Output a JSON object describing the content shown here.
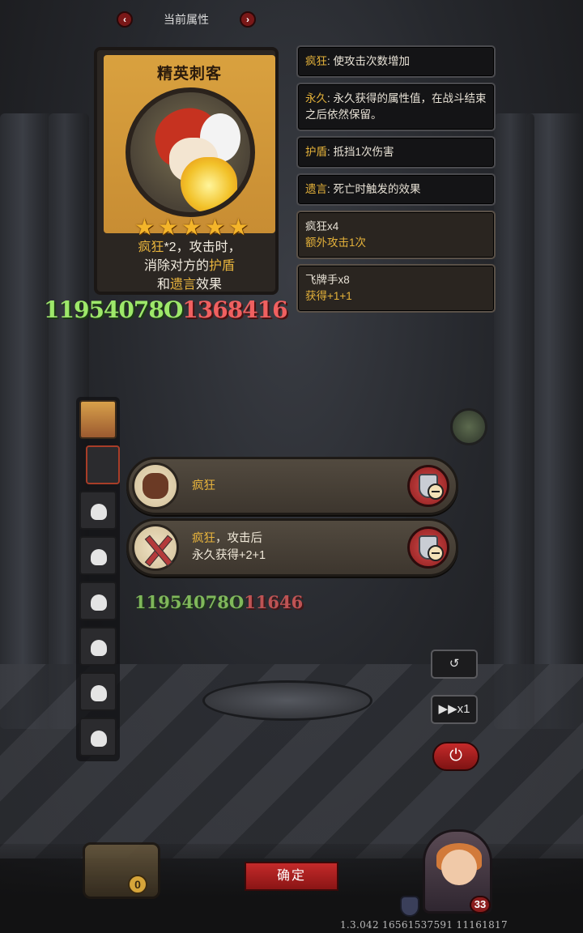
{
  "header": {
    "title": "当前属性",
    "prev_icon": "chevron-left-icon",
    "next_icon": "chevron-right-icon"
  },
  "card": {
    "title": "精英刺客",
    "stars": 5,
    "desc_line1_kw": "疯狂",
    "desc_line1_rest": "*2，攻击时，",
    "desc_line2_a": "消除对方的",
    "desc_line2_kw": "护盾",
    "desc_line3_a": "和",
    "desc_line3_kw": "遗言",
    "desc_line3_b": "效果"
  },
  "damage": {
    "green": "11954078O",
    "red": "1368416",
    "overlay": "11954078O11646"
  },
  "info_panels": [
    {
      "keyword": "疯狂",
      "text": ": 使攻击次数增加"
    },
    {
      "keyword": "永久",
      "text": ": 永久获得的属性值，在战斗结束之后依然保留。"
    },
    {
      "keyword": "护盾",
      "text": ": 抵挡1次伤害"
    },
    {
      "keyword": "遗言",
      "text": ": 死亡时触发的效果"
    },
    {
      "title": "疯狂x4",
      "sub": "额外攻击1次"
    },
    {
      "title": "飞牌手x8",
      "sub": "获得+1+1"
    }
  ],
  "effects": [
    {
      "line1": "疯狂",
      "line2": ""
    },
    {
      "line1": "疯狂，攻击后",
      "line2": "永久获得+2+1"
    }
  ],
  "controls": {
    "undo_icon": "undo-icon",
    "speed_label": "▶▶x1",
    "power_icon": "power-icon"
  },
  "footer": {
    "confirm_label": "确定",
    "chest_count": "0",
    "level": "33",
    "version": "1.3.042 16561537591 11161817"
  },
  "colors": {
    "accent_gold": "#e5b23a",
    "button_red": "#c42a2a"
  }
}
